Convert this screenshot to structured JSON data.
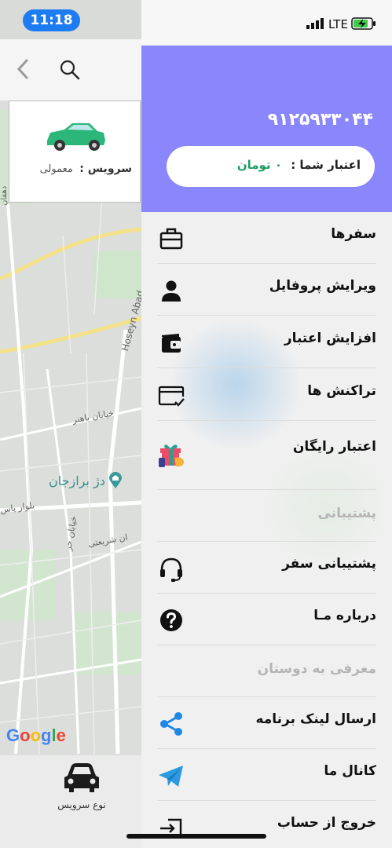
{
  "status": {
    "time": "11:18",
    "network": "LTE"
  },
  "map": {
    "service_card": {
      "label": "سرویس :",
      "value": "معمولی"
    },
    "labels": [
      "Hoseyn Abad",
      "خیابان باهنر",
      "بلوار یاس",
      "خیابان حر",
      "ان شریعتی",
      "دهقان"
    ],
    "poi": "دژ برازجان",
    "google": [
      "G",
      "o",
      "o",
      "g",
      "l",
      "e"
    ],
    "service_tab_label": "نوع سرویس"
  },
  "drawer": {
    "phone": "۹۱۲۵۹۳۳۰۴۴",
    "credit_label": "اعتبار شما :",
    "credit_value": "۰ تومان",
    "menu": [
      {
        "label": "سفرها",
        "icon": "briefcase-icon"
      },
      {
        "label": "ویرایش پروفایل",
        "icon": "person-icon"
      },
      {
        "label": "افزایش اعتبار",
        "icon": "wallet-icon"
      },
      {
        "label": "تراکنش ها",
        "icon": "card-check-icon"
      },
      {
        "label": "اعتبار رایگان",
        "icon": "gift-icon"
      }
    ],
    "support_header": "پشتیبانی",
    "support_menu": [
      {
        "label": "پشتیبانی سفر",
        "icon": "headset-icon"
      },
      {
        "label": "درباره مـا",
        "icon": "question-icon"
      }
    ],
    "invite_header": "معرفی به دوستان",
    "invite_menu": [
      {
        "label": "ارسال لینک برنامه",
        "icon": "share-icon"
      },
      {
        "label": "کانال ما",
        "icon": "telegram-icon"
      },
      {
        "label": "خروج از حساب",
        "icon": "logout-icon"
      }
    ]
  },
  "colors": {
    "header": "#8a86fb",
    "credit_amount": "#1f9e63",
    "time_pill": "#1e7cf2",
    "share_blue": "#1e88e5",
    "telegram_blue": "#2b9ae0"
  }
}
